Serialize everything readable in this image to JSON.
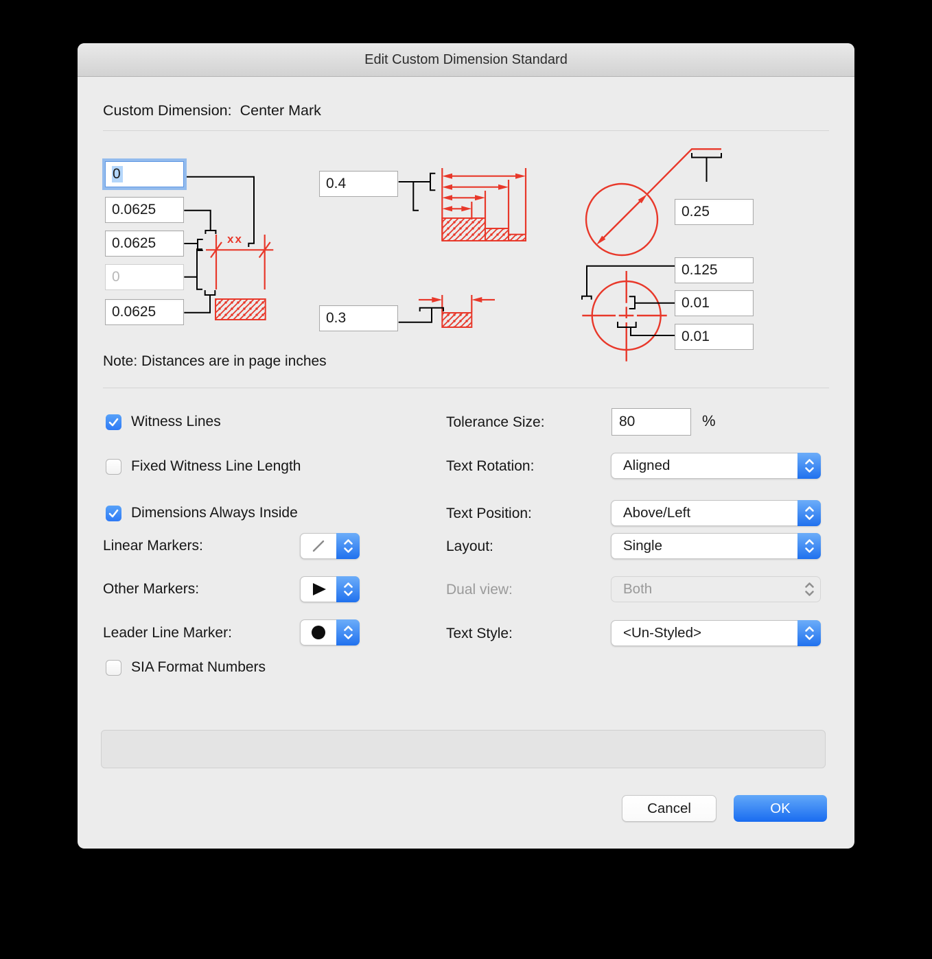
{
  "window": {
    "title": "Edit Custom Dimension Standard"
  },
  "header": {
    "label": "Custom Dimension:",
    "value": "Center Mark"
  },
  "preview": {
    "note": "Note: Distances are in page inches",
    "sample_text": "xx",
    "left_fields": [
      {
        "value": "0",
        "state": "focused"
      },
      {
        "value": "0.0625",
        "state": "normal"
      },
      {
        "value": "0.0625",
        "state": "normal"
      },
      {
        "value": "0",
        "state": "disabled"
      },
      {
        "value": "0.0625",
        "state": "normal"
      }
    ],
    "middle_fields": [
      {
        "value": "0.4"
      },
      {
        "value": "0.3"
      }
    ],
    "right_fields": [
      {
        "value": "0.25"
      },
      {
        "value": "0.125"
      },
      {
        "value": "0.01"
      },
      {
        "value": "0.01"
      }
    ]
  },
  "options": {
    "witness_lines": {
      "label": "Witness Lines",
      "checked": true
    },
    "fixed_witness_line_length": {
      "label": "Fixed Witness Line Length",
      "checked": false
    },
    "dimensions_always_inside": {
      "label": "Dimensions Always Inside",
      "checked": true
    },
    "sia_format_numbers": {
      "label": "SIA Format Numbers",
      "checked": false
    }
  },
  "markers": {
    "linear": {
      "label": "Linear Markers:",
      "glyph": "slash"
    },
    "other": {
      "label": "Other Markers:",
      "glyph": "filled-triangle"
    },
    "leader": {
      "label": "Leader Line Marker:",
      "glyph": "filled-circle"
    }
  },
  "settings": {
    "tolerance_size": {
      "label": "Tolerance Size:",
      "value": "80",
      "unit": "%"
    },
    "text_rotation": {
      "label": "Text Rotation:",
      "value": "Aligned",
      "disabled": false
    },
    "text_position": {
      "label": "Text Position:",
      "value": "Above/Left",
      "disabled": false
    },
    "layout": {
      "label": "Layout:",
      "value": "Single",
      "disabled": false
    },
    "dual_view": {
      "label": "Dual view:",
      "value": "Both",
      "disabled": true
    },
    "text_style": {
      "label": "Text Style:",
      "value": "<Un-Styled>",
      "disabled": false
    }
  },
  "footer": {
    "cancel_label": "Cancel",
    "ok_label": "OK"
  },
  "colors": {
    "diagram_red": "#e8382a",
    "accent_blue": "#2e7af5",
    "dialog_bg": "#ececec"
  }
}
